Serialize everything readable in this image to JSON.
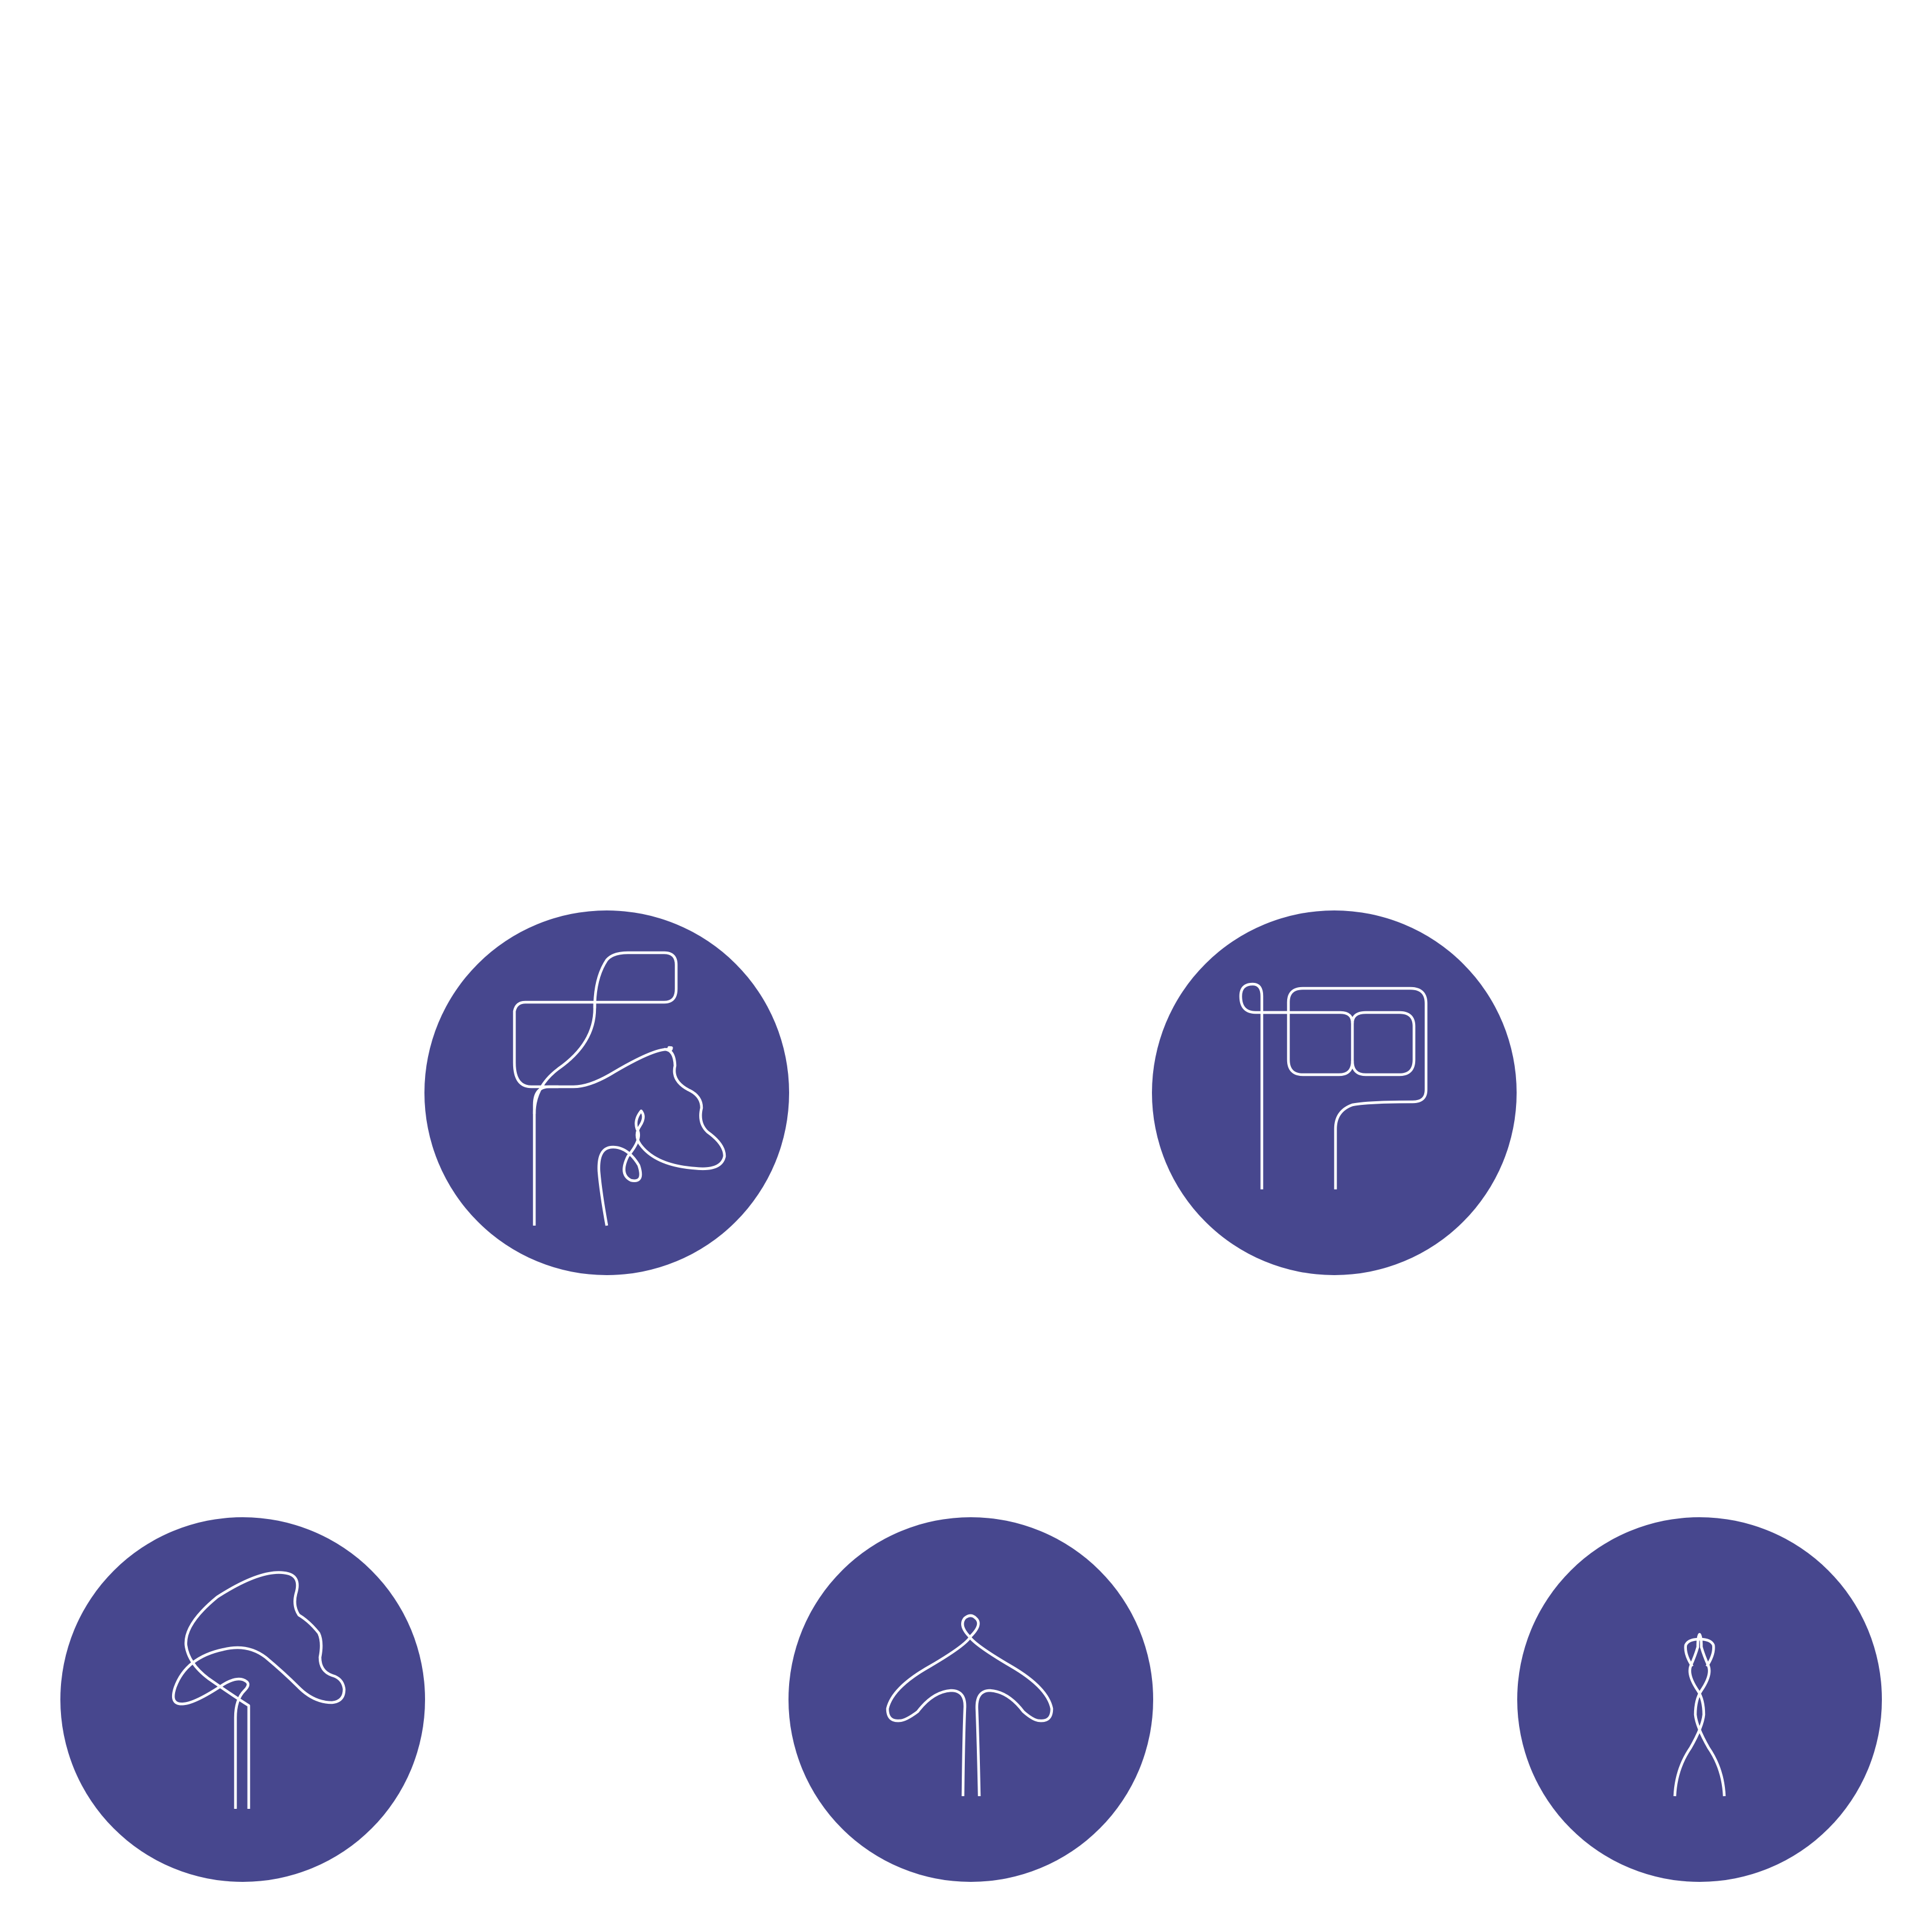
{
  "palette": {
    "background": "#ffffff",
    "disc": "#47478e",
    "line": "#ffffff"
  },
  "figures": [
    {
      "name": "string-figure-1",
      "icon": "string-figure-icon"
    },
    {
      "name": "string-figure-2",
      "icon": "string-figure-icon"
    },
    {
      "name": "string-figure-3",
      "icon": "string-figure-icon"
    },
    {
      "name": "string-figure-4",
      "icon": "string-figure-icon"
    },
    {
      "name": "string-figure-5",
      "icon": "string-figure-icon"
    }
  ]
}
